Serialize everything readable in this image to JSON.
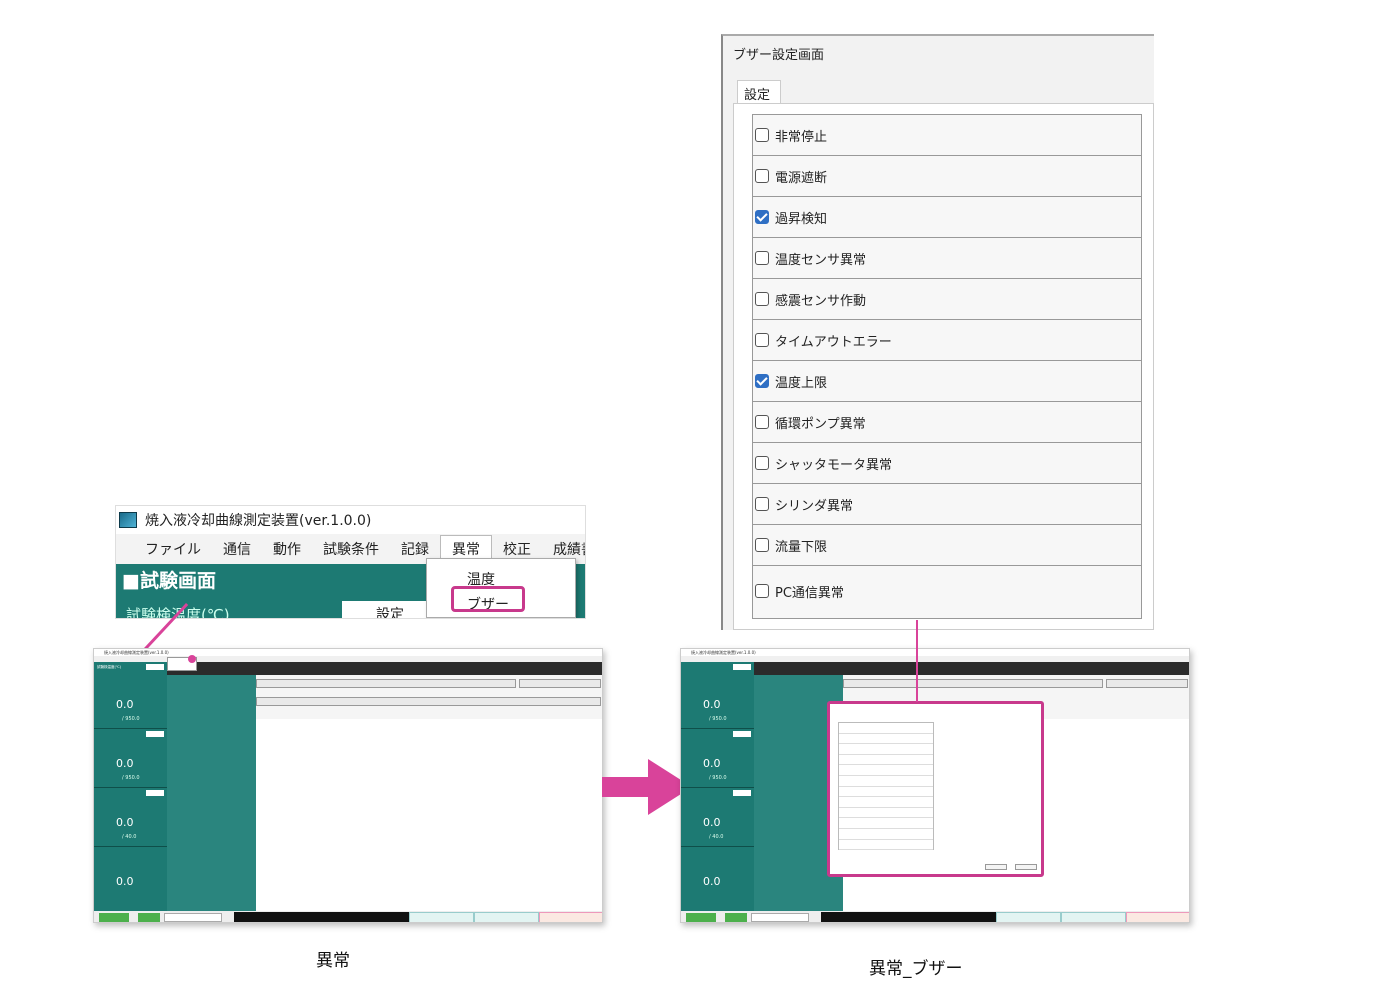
{
  "app": {
    "window_title": "焼入液冷却曲線測定装置(ver.1.0.0)",
    "screen_title": "■試験画面",
    "sub_caption": "試験検温度(℃)",
    "settings_tab": "設定"
  },
  "menu_bar": {
    "items": [
      "ファイル",
      "通信",
      "動作",
      "試験条件",
      "記録",
      "異常",
      "校正",
      "成績書"
    ],
    "active_item": "異常"
  },
  "abnormal_menu": {
    "items": [
      "温度",
      "ブザー"
    ],
    "highlighted": "ブザー"
  },
  "mini_app": {
    "readings": [
      "0.0",
      "0.0",
      "0.0",
      "0.0"
    ],
    "limits": [
      "/ 950.0",
      "/ 950.0",
      "/ 40.0"
    ]
  },
  "buzzer_dialog": {
    "title": "ブザー設定画面",
    "tab": "設定",
    "items": [
      {
        "label": "非常停止",
        "checked": false
      },
      {
        "label": "電源遮断",
        "checked": false
      },
      {
        "label": "過昇検知",
        "checked": true
      },
      {
        "label": "温度センサ異常",
        "checked": false
      },
      {
        "label": "感震センサ作動",
        "checked": false
      },
      {
        "label": "タイムアウトエラー",
        "checked": false
      },
      {
        "label": "温度上限",
        "checked": true
      },
      {
        "label": "循環ポンプ異常",
        "checked": false
      },
      {
        "label": "シャッタモータ異常",
        "checked": false
      },
      {
        "label": "シリンダ異常",
        "checked": false
      },
      {
        "label": "流量下限",
        "checked": false
      },
      {
        "label": "PC通信異常",
        "checked": false
      }
    ]
  },
  "captions": {
    "left": "異常",
    "right": "異常_ブザー"
  },
  "colors": {
    "teal": "#1d7a73",
    "highlight": "#c8398c",
    "checkbox_on": "#2f6fc4"
  }
}
